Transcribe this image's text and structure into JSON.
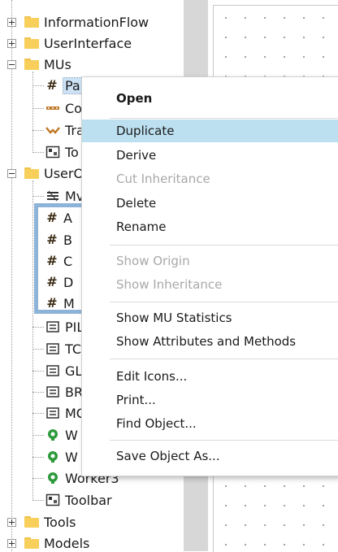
{
  "tree": {
    "items": [
      {
        "label": "InformationFlow",
        "icon": "folder-icon"
      },
      {
        "label": "UserInterface",
        "icon": "folder-icon"
      },
      {
        "label": "MUs",
        "icon": "folder-icon"
      },
      {
        "label": "Pal",
        "icon": "mu-hash-icon"
      },
      {
        "label": "Co",
        "icon": "conveyor-icon"
      },
      {
        "label": "Tra",
        "icon": "transporter-icon"
      },
      {
        "label": "To",
        "icon": "toolbar-icon"
      },
      {
        "label": "UserO",
        "icon": "folder-icon"
      },
      {
        "label": "Mv",
        "icon": "layers-icon"
      },
      {
        "label": "A",
        "icon": "mu-hash-icon"
      },
      {
        "label": "B",
        "icon": "mu-hash-icon"
      },
      {
        "label": "C",
        "icon": "mu-hash-icon"
      },
      {
        "label": "D",
        "icon": "mu-hash-icon"
      },
      {
        "label": "M",
        "icon": "mu-hash-icon"
      },
      {
        "label": "PIL",
        "icon": "list-icon"
      },
      {
        "label": "TC",
        "icon": "list-icon"
      },
      {
        "label": "GL",
        "icon": "list-icon"
      },
      {
        "label": "BR",
        "icon": "list-icon"
      },
      {
        "label": "MC",
        "icon": "list-icon"
      },
      {
        "label": "W",
        "icon": "worker-icon"
      },
      {
        "label": "W",
        "icon": "worker-icon"
      },
      {
        "label": "Worker3",
        "icon": "worker-icon"
      },
      {
        "label": "Toolbar",
        "icon": "toolbar-icon"
      },
      {
        "label": "Tools",
        "icon": "folder-icon"
      },
      {
        "label": "Models",
        "icon": "folder-icon"
      }
    ]
  },
  "context_menu": {
    "open": "Open",
    "duplicate": "Duplicate",
    "derive": "Derive",
    "cut_inheritance": "Cut Inheritance",
    "delete": "Delete",
    "rename": "Rename",
    "show_origin": "Show Origin",
    "show_inheritance": "Show Inheritance",
    "show_mu_statistics": "Show MU Statistics",
    "show_attributes_methods": "Show Attributes and Methods",
    "edit_icons": "Edit Icons...",
    "print": "Print...",
    "find_object": "Find Object...",
    "save_object_as": "Save Object As..."
  },
  "colors": {
    "menu_highlight": "#bde0f0",
    "selection_box": "#8db3d8",
    "folder": "#f7cf5a",
    "worker_green": "#2e9a3c"
  }
}
